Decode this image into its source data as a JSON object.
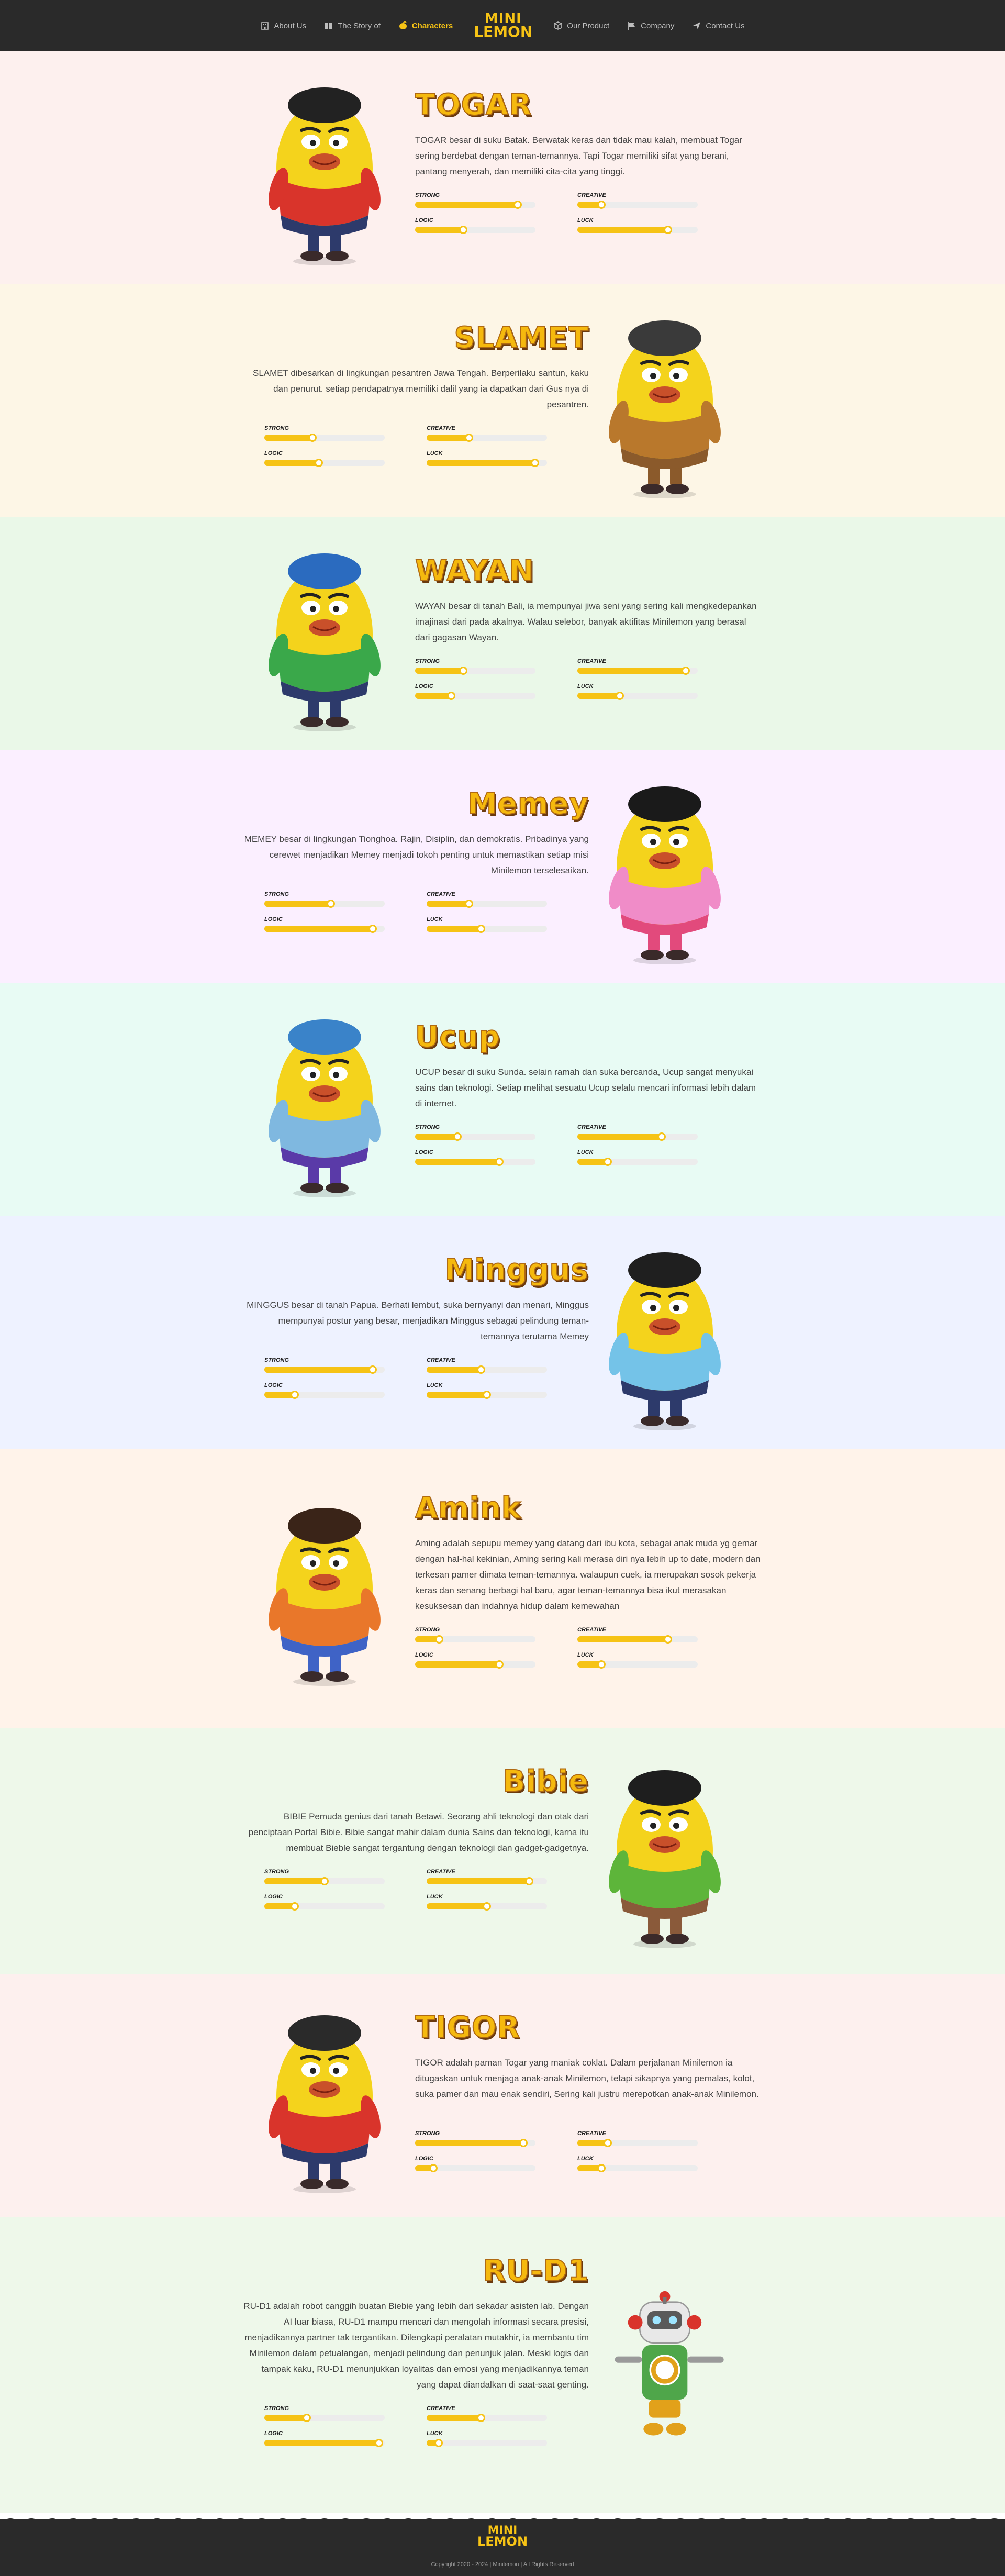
{
  "nav": {
    "left": [
      {
        "label": "About Us",
        "icon": "building-icon"
      },
      {
        "label": "The Story of",
        "icon": "book-icon"
      },
      {
        "label": "Characters",
        "icon": "lemon-icon",
        "active": true
      }
    ],
    "logo": {
      "line1": "MINI",
      "line2": "LEMON"
    },
    "right": [
      {
        "label": "Our Product",
        "icon": "box-icon"
      },
      {
        "label": "Company",
        "icon": "flag-icon"
      },
      {
        "label": "Contact Us",
        "icon": "send-icon"
      }
    ]
  },
  "stat_labels": {
    "strong": "STRONG",
    "creative": "CREATIVE",
    "logic": "LOGIC",
    "luck": "LUCK"
  },
  "characters": [
    {
      "name": "TOGAR",
      "bg": "#fdf0ee",
      "side": "left",
      "colors": {
        "body": "#f4d31c",
        "shirt": "#d9342b",
        "pants": "#2d3a6b",
        "hair": "#222222"
      },
      "desc": "TOGAR besar di suku Batak. Berwatak keras dan tidak mau kalah, membuat Togar sering berdebat dengan teman-temannya. Tapi Togar memiliki sifat yang berani, pantang menyerah, dan memiliki cita-cita yang tinggi.",
      "stats": {
        "strong": 0.85,
        "creative": 0.2,
        "logic": 0.4,
        "luck": 0.75
      }
    },
    {
      "name": "SLAMET",
      "bg": "#fdf6e6",
      "side": "right",
      "colors": {
        "body": "#f4d31c",
        "shirt": "#b9782c",
        "pants": "#8b5a2b",
        "hair": "#3a3a3a"
      },
      "desc": "SLAMET dibesarkan di lingkungan pesantren Jawa Tengah. Berperilaku santun, kaku dan penurut. setiap pendapatnya memiliki dalil yang ia dapatkan dari Gus nya di pesantren.",
      "stats": {
        "strong": 0.4,
        "creative": 0.35,
        "logic": 0.45,
        "luck": 0.9
      }
    },
    {
      "name": "WAYAN",
      "bg": "#eaf8e8",
      "side": "left",
      "colors": {
        "body": "#f4d31c",
        "shirt": "#3aa84a",
        "pants": "#2d3a6b",
        "hair": "#2b6bbf"
      },
      "desc": "WAYAN besar di tanah Bali, ia mempunyai jiwa seni yang sering kali mengkedepankan imajinasi dari pada akalnya. Walau selebor, banyak aktifitas Minilemon yang berasal dari gagasan Wayan.",
      "stats": {
        "strong": 0.4,
        "creative": 0.9,
        "logic": 0.3,
        "luck": 0.35
      }
    },
    {
      "name": "Memey",
      "bg": "#fbefff",
      "side": "right",
      "colors": {
        "body": "#f4d31c",
        "shirt": "#f08cc8",
        "pants": "#e24a7c",
        "hair": "#1a1a1a"
      },
      "desc": "MEMEY besar di lingkungan Tionghoa. Rajin, Disiplin, dan demokratis. Pribadinya yang cerewet menjadikan Memey menjadi tokoh penting untuk memastikan setiap misi Minilemon terselesaikan.",
      "stats": {
        "strong": 0.55,
        "creative": 0.35,
        "logic": 0.9,
        "luck": 0.45
      }
    },
    {
      "name": "Ucup",
      "bg": "#e8fbf4",
      "side": "left",
      "colors": {
        "body": "#f4d31c",
        "shirt": "#7fb8e0",
        "pants": "#5a3aa8",
        "hair": "#3a83c9"
      },
      "desc": "UCUP besar di suku Sunda. selain ramah dan suka bercanda, Ucup sangat menyukai sains dan teknologi. Setiap melihat sesuatu Ucup selalu mencari informasi lebih dalam di internet.",
      "stats": {
        "strong": 0.35,
        "creative": 0.7,
        "logic": 0.7,
        "luck": 0.25
      }
    },
    {
      "name": "Minggus",
      "bg": "#eef2ff",
      "side": "right",
      "colors": {
        "body": "#f4d31c",
        "shirt": "#74c3e8",
        "pants": "#2d3a6b",
        "hair": "#1f1f1f"
      },
      "desc": "MINGGUS besar di tanah Papua. Berhati lembut, suka bernyanyi dan menari, Minggus mempunyai postur yang besar, menjadikan Minggus sebagai pelindung teman-temannya terutama Memey",
      "stats": {
        "strong": 0.9,
        "creative": 0.45,
        "logic": 0.25,
        "luck": 0.5
      }
    },
    {
      "name": "Amink",
      "bg": "#fff3ea",
      "side": "left",
      "colors": {
        "body": "#f4d31c",
        "shirt": "#e9772a",
        "pants": "#3f63c6",
        "hair": "#3a2418"
      },
      "desc": "Aming adalah sepupu memey yang datang dari ibu kota, sebagai anak muda yg gemar dengan hal-hal kekinian, Aming sering kali merasa diri nya lebih up to date, modern dan terkesan pamer dimata teman-temannya. walaupun cuek, ia merupakan sosok pekerja keras dan senang berbagi hal baru, agar teman-temannya bisa ikut merasakan kesuksesan dan indahnya hidup dalam kemewahan",
      "stats": {
        "strong": 0.2,
        "creative": 0.75,
        "logic": 0.7,
        "luck": 0.2
      }
    },
    {
      "name": "Bibie",
      "bg": "#eef8ea",
      "side": "right",
      "colors": {
        "body": "#f4d31c",
        "shirt": "#5db53a",
        "pants": "#8a5a3a",
        "hair": "#1e1e1e"
      },
      "desc": "BIBIE Pemuda genius dari tanah Betawi. Seorang ahli teknologi dan otak dari penciptaan Portal Bibie. Bibie sangat mahir dalam dunia Sains dan teknologi, karna itu membuat Bieble sangat tergantung dengan teknologi dan gadget-gadgetnya.",
      "stats": {
        "strong": 0.5,
        "creative": 0.85,
        "logic": 0.25,
        "luck": 0.5
      }
    },
    {
      "name": "TIGOR",
      "bg": "#fdf0ee",
      "side": "left",
      "colors": {
        "body": "#f4d31c",
        "shirt": "#d9342b",
        "pants": "#2d3a6b",
        "hair": "#2a2a2a"
      },
      "desc": "TIGOR adalah paman Togar yang maniak coklat. Dalam perjalanan Minilemon ia ditugaskan untuk menjaga anak-anak Minilemon, tetapi sikapnya yang pemalas, kolot, suka pamer dan mau enak sendiri, Sering kali justru merepotkan anak-anak Minilemon.",
      "stats": {
        "strong": 0.9,
        "creative": 0.25,
        "logic": 0.15,
        "luck": 0.2
      }
    },
    {
      "name": "RU-D1",
      "bg": "#eef8ea",
      "side": "right",
      "colors": {
        "body": "#f4d31c",
        "shirt": "#4fa64a",
        "pants": "#e2a11a",
        "hair": "#d9342b"
      },
      "desc": "RU-D1 adalah robot canggih buatan Biebie yang lebih dari sekadar asisten lab. Dengan AI luar biasa, RU-D1 mampu mencari dan mengolah informasi secara presisi, menjadikannya partner tak tergantikan. Dilengkapi peralatan mutakhir, ia membantu tim Minilemon dalam petualangan, menjadi pelindung dan penunjuk jalan. Meski logis dan tampak kaku, RU-D1 menunjukkan loyalitas dan emosi yang menjadikannya teman yang dapat diandalkan di saat-saat genting.",
      "stats": {
        "strong": 0.35,
        "creative": 0.45,
        "logic": 0.95,
        "luck": 0.1
      }
    }
  ],
  "footer": {
    "logo_line1": "MINI",
    "logo_line2": "LEMON",
    "copyright": "Copyright 2020 - 2024 | Minilemon | All Rights Reserved"
  }
}
